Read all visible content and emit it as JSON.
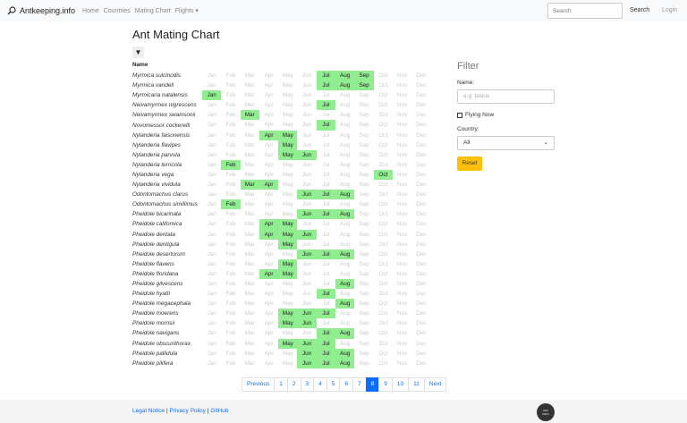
{
  "nav": {
    "brand": "Antkeeping.info",
    "links": [
      "Home",
      "Countries",
      "Mating Chart",
      "Flights ▾"
    ],
    "search_placeholder": "Search",
    "search_button": "Search",
    "login": "Login"
  },
  "page_title": "Ant Mating Chart",
  "table": {
    "name_header": "Name",
    "months": [
      "Jan",
      "Feb",
      "Mar",
      "Apr",
      "May",
      "Jun",
      "Jul",
      "Aug",
      "Sep",
      "Oct",
      "Nov",
      "Dec"
    ],
    "rows": [
      {
        "name": "Myrmica sulcinodis",
        "flying": [
          "Jul",
          "Aug",
          "Sep"
        ]
      },
      {
        "name": "Myrmica vandeli",
        "flying": [
          "Jul",
          "Aug",
          "Sep"
        ]
      },
      {
        "name": "Myrmicaria natalensis",
        "flying": [
          "Jan"
        ]
      },
      {
        "name": "Neivamyrmex nigrescens",
        "flying": [
          "Jul"
        ]
      },
      {
        "name": "Neivamyrmex swainsonii",
        "flying": [
          "Mar"
        ]
      },
      {
        "name": "Novomessor cockerelli",
        "flying": [
          "Jul"
        ]
      },
      {
        "name": "Nylanderia faisonensis",
        "flying": [
          "Apr",
          "May"
        ]
      },
      {
        "name": "Nylanderia flavipes",
        "flying": [
          "May"
        ]
      },
      {
        "name": "Nylanderia parvula",
        "flying": [
          "May",
          "Jun"
        ]
      },
      {
        "name": "Nylanderia terricola",
        "flying": [
          "Feb"
        ]
      },
      {
        "name": "Nylanderia vega",
        "flying": [
          "Oct"
        ]
      },
      {
        "name": "Nylanderia vividula",
        "flying": [
          "Mar",
          "Apr"
        ]
      },
      {
        "name": "Odontomachus clarus",
        "flying": [
          "Jun",
          "Jul",
          "Aug"
        ]
      },
      {
        "name": "Odontomachus simillimus",
        "flying": [
          "Feb"
        ]
      },
      {
        "name": "Pheidole bicarinata",
        "flying": [
          "Jun",
          "Jul",
          "Aug"
        ]
      },
      {
        "name": "Pheidole californica",
        "flying": [
          "Apr",
          "May"
        ]
      },
      {
        "name": "Pheidole dentata",
        "flying": [
          "Apr",
          "May",
          "Jun"
        ]
      },
      {
        "name": "Pheidole dentigula",
        "flying": [
          "May"
        ]
      },
      {
        "name": "Pheidole desertorum",
        "flying": [
          "Jun",
          "Jul",
          "Aug"
        ]
      },
      {
        "name": "Pheidole flavens",
        "flying": [
          "May"
        ]
      },
      {
        "name": "Pheidole floridana",
        "flying": [
          "Apr",
          "May"
        ]
      },
      {
        "name": "Pheidole gilvescens",
        "flying": [
          "Aug"
        ]
      },
      {
        "name": "Pheidole hyatti",
        "flying": [
          "Jul"
        ]
      },
      {
        "name": "Pheidole megacephala",
        "flying": [
          "Aug"
        ]
      },
      {
        "name": "Pheidole moerens",
        "flying": [
          "May",
          "Jun",
          "Jul"
        ]
      },
      {
        "name": "Pheidole morrisii",
        "flying": [
          "May",
          "Jun"
        ]
      },
      {
        "name": "Pheidole navigans",
        "flying": [
          "Jul",
          "Aug"
        ]
      },
      {
        "name": "Pheidole obscurithorax",
        "flying": [
          "May",
          "Jun",
          "Jul"
        ]
      },
      {
        "name": "Pheidole pallidula",
        "flying": [
          "Jun",
          "Jul",
          "Aug"
        ]
      },
      {
        "name": "Pheidole pilifera",
        "flying": [
          "Jun",
          "Jul",
          "Aug"
        ]
      }
    ]
  },
  "filter": {
    "title": "Filter",
    "name_label": "Name:",
    "name_placeholder": "e.g. lasius",
    "flying_now": "Flying Now",
    "country_label": "Country:",
    "country_value": "All",
    "reset": "Reset"
  },
  "pagination": {
    "previous": "Previous",
    "pages": [
      "1",
      "2",
      "3",
      "4",
      "5",
      "6",
      "7",
      "8",
      "9",
      "10",
      "11"
    ],
    "current": "8",
    "next": "Next"
  },
  "footer": {
    "legal": "Legal Notice",
    "privacy": "Privacy Policy",
    "github": "GitHub",
    "sep": " | ",
    "logo_text": "Ant Keeping Info"
  },
  "colors": {
    "highlight": "#90ee90",
    "accent": "#0d6efd",
    "reset": "#ffc107"
  }
}
